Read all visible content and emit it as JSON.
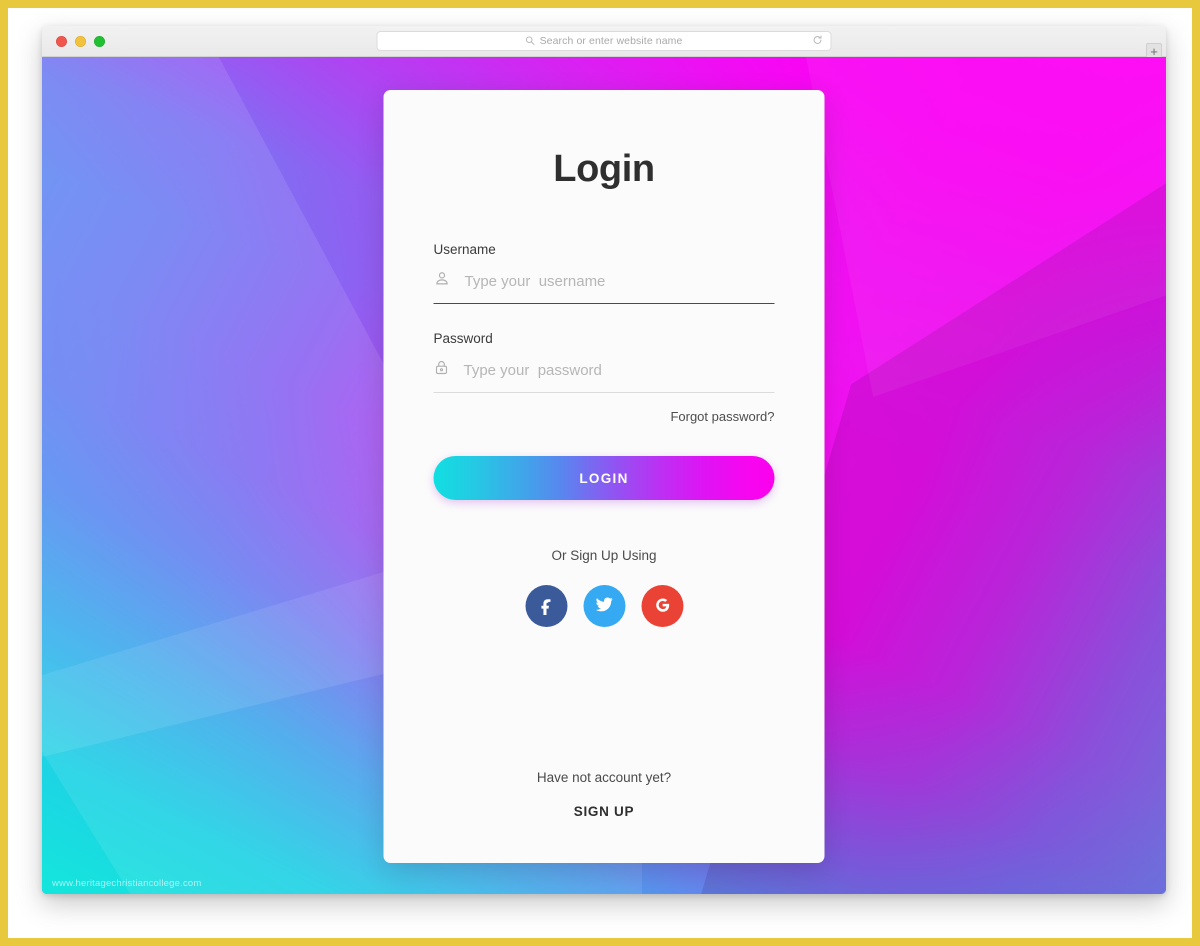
{
  "browser": {
    "traffic_lights": [
      "close",
      "minimize",
      "zoom"
    ],
    "address_bar": {
      "placeholder": "Search or enter website name",
      "value": "",
      "search_icon": "search-icon",
      "reload_icon": "reload-icon"
    },
    "new_tab_label": "+"
  },
  "card": {
    "title": "Login",
    "username": {
      "label": "Username",
      "placeholder": "Type your  username",
      "value": "",
      "icon": "user-icon"
    },
    "password": {
      "label": "Password",
      "placeholder": "Type your  password",
      "value": "",
      "icon": "lock-icon"
    },
    "forgot_password": "Forgot password?",
    "login_button": "LOGIN",
    "or_sign_up_using": "Or Sign Up Using",
    "social": [
      {
        "name": "facebook",
        "label": "f",
        "color": "#3b5a9a"
      },
      {
        "name": "twitter",
        "label": "t",
        "color": "#35a9f2"
      },
      {
        "name": "google",
        "label": "G",
        "color": "#ea4335"
      }
    ],
    "have_account": "Have not account yet?",
    "sign_up": "SIGN UP"
  },
  "watermark": "www.heritagechristiancollege.com",
  "colors": {
    "frame": "#e8c83c",
    "card_bg": "#fbfbfb",
    "title": "#2f2f2f",
    "button_gradient_start": "#10dfe0",
    "button_gradient_mid": "#8d57f2",
    "button_gradient_end": "#fa00ee",
    "bg_cyan": "#14e6dc",
    "bg_blue": "#5e8df2",
    "bg_purple": "#8b63f2",
    "bg_magenta": "#f50ff2"
  }
}
